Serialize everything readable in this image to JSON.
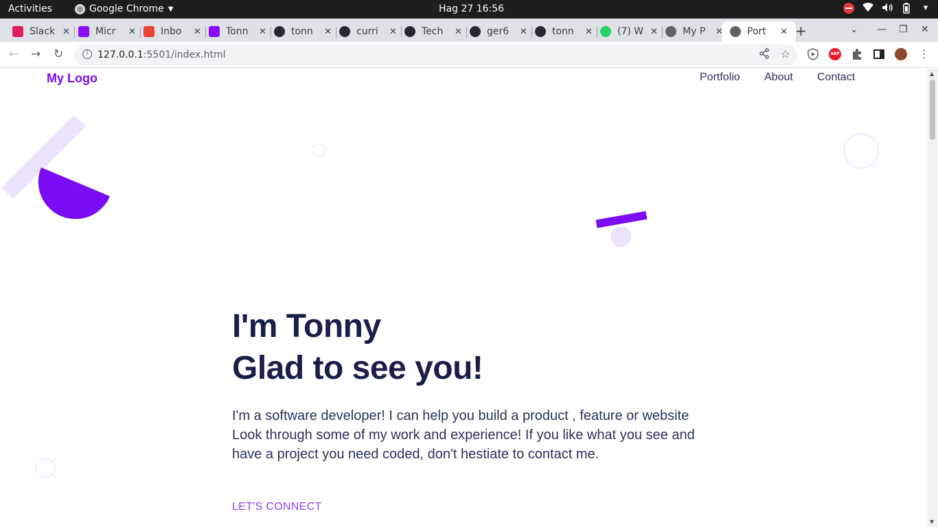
{
  "system": {
    "activities": "Activities",
    "app_name": "Google Chrome",
    "clock": "Hag 27  16:56"
  },
  "tabs": [
    {
      "title": "Slack",
      "favicon_color": "#e01e5a"
    },
    {
      "title": "Micr",
      "favicon_color": "#8a0bf5"
    },
    {
      "title": "Inbo",
      "favicon_color": "#ea4335"
    },
    {
      "title": "Tonn",
      "favicon_color": "#8a0bf5"
    },
    {
      "title": "tonn",
      "favicon_color": "#24292f"
    },
    {
      "title": "curri",
      "favicon_color": "#24292f"
    },
    {
      "title": "Tech",
      "favicon_color": "#24292f"
    },
    {
      "title": "ger6",
      "favicon_color": "#24292f"
    },
    {
      "title": "tonn",
      "favicon_color": "#24292f"
    },
    {
      "title": "(7) W",
      "favicon_color": "#25d366"
    },
    {
      "title": "My P",
      "favicon_color": "#5f6368"
    },
    {
      "title": "Port",
      "favicon_color": "#5f6368",
      "active": true
    }
  ],
  "browser": {
    "url_host": "127.0.0.1",
    "url_rest": ":5501/index.html",
    "abp_label": "ABP"
  },
  "site": {
    "logo": "My Logo",
    "nav": [
      "Portfolio",
      "About",
      "Contact"
    ],
    "heading_line1": "I'm Tonny",
    "heading_line2": "Glad to see you!",
    "intro": "I'm a software developer! I can help you build a product , feature or website Look through some of my work and experience! If you like what you see and have a project you need coded, don't hestiate to contact me.",
    "cta": "LET'S CONNECT"
  },
  "colors": {
    "brand": "#7a0bf5",
    "heading": "#1a1e4a",
    "body_text": "#29325a",
    "cta": "#8b44f0",
    "light_purple": "#ece4fd"
  }
}
